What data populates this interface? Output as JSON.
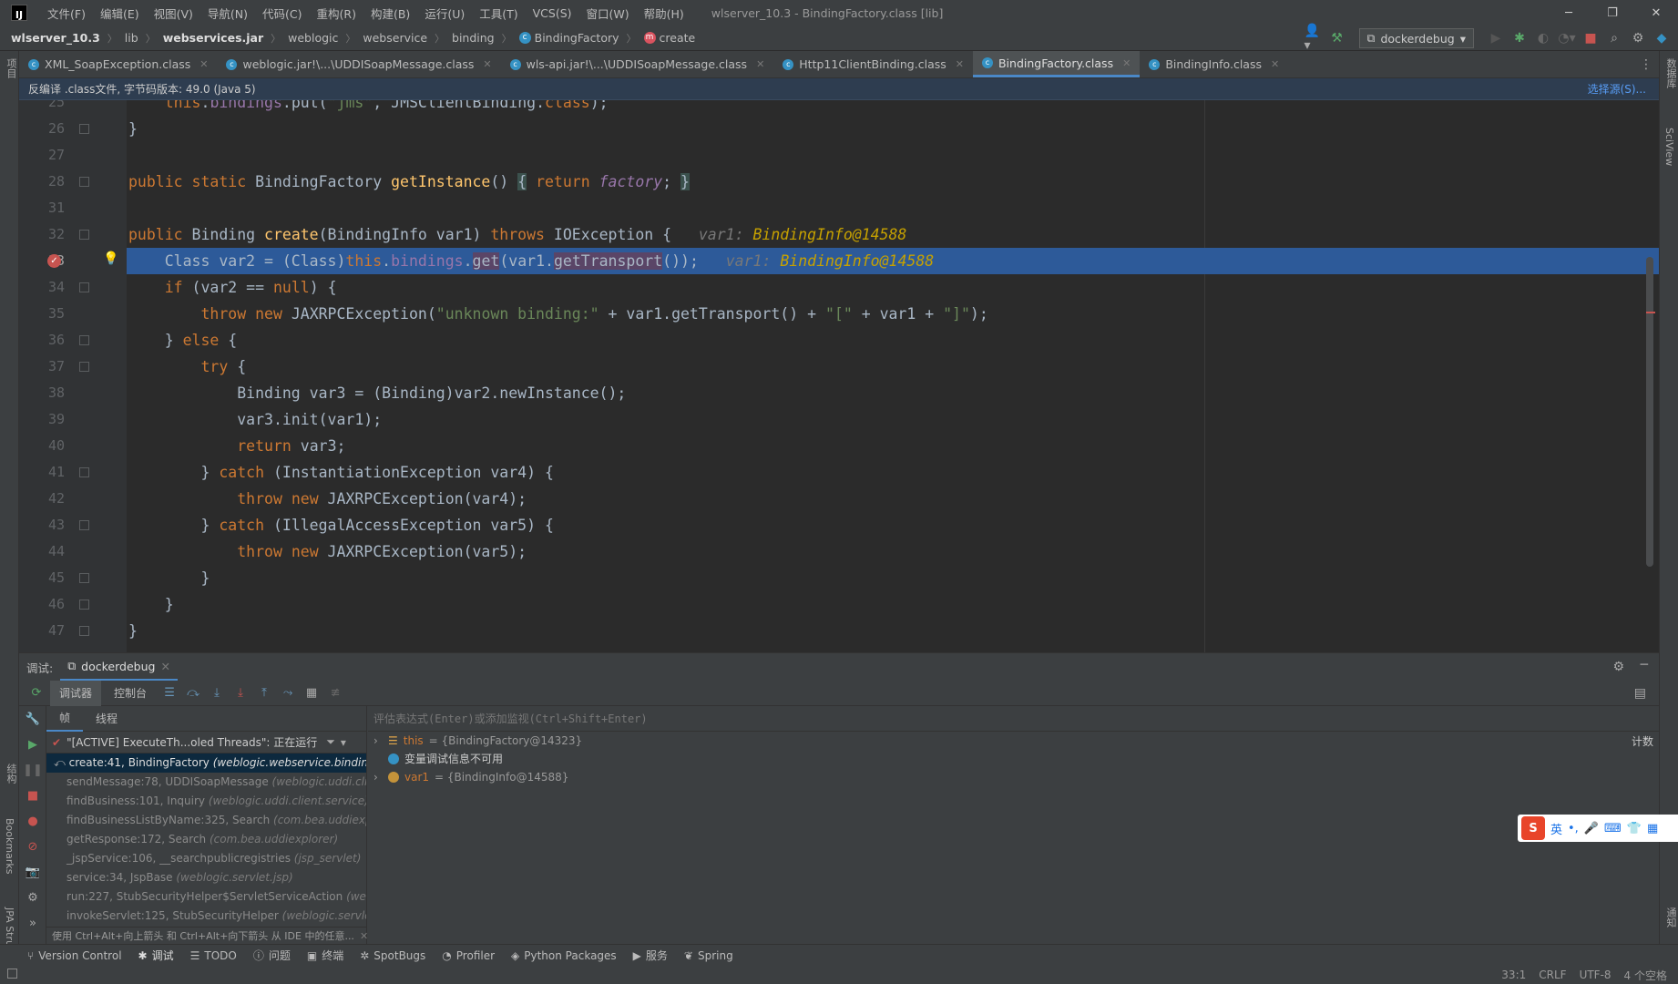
{
  "menu": {
    "items": [
      "文件(F)",
      "编辑(E)",
      "视图(V)",
      "导航(N)",
      "代码(C)",
      "重构(R)",
      "构建(B)",
      "运行(U)",
      "工具(T)",
      "VCS(S)",
      "窗口(W)",
      "帮助(H)"
    ],
    "window_title": "wlserver_10.3 - BindingFactory.class [lib]"
  },
  "breadcrumb": {
    "project": "wlserver_10.3",
    "lib": "lib",
    "jar": "webservices.jar",
    "pkg1": "weblogic",
    "pkg2": "webservice",
    "pkg3": "binding",
    "cls": "BindingFactory",
    "method": "create"
  },
  "toolbar": {
    "run_config": "dockerdebug"
  },
  "tabs": [
    {
      "label": "XML_SoapException.class"
    },
    {
      "label": "weblogic.jar!\\...\\UDDISoapMessage.class"
    },
    {
      "label": "wls-api.jar!\\...\\UDDISoapMessage.class"
    },
    {
      "label": "Http11ClientBinding.class"
    },
    {
      "label": "BindingFactory.class"
    },
    {
      "label": "BindingInfo.class"
    }
  ],
  "infobar": {
    "text": "反编译 .class文件, 字节码版本: 49.0 (Java 5)",
    "link": "选择源(S)..."
  },
  "editor": {
    "line_numbers": [
      "25",
      "26",
      "27",
      "28",
      "31",
      "32",
      "33",
      "34",
      "35",
      "36",
      "37",
      "38",
      "39",
      "40",
      "41",
      "42",
      "43",
      "44",
      "45",
      "46",
      "47"
    ],
    "hint1": "var1: ",
    "hint1_val": "BindingInfo@14588",
    "hint2": "var1: ",
    "hint2_val": "BindingInfo@14588",
    "exc_msg": "\"unknown binding:\"",
    "lb": "\"[\"",
    "rb": "\"]\""
  },
  "left_tool": {
    "project": "项目",
    "bookmarks": "Bookmarks",
    "structure": "结构",
    "jpa": "JPA Structure"
  },
  "right_tool": {
    "db": "数据库",
    "sciview": "SciView",
    "notify": "通知"
  },
  "debug": {
    "label": "调试:",
    "config": "dockerdebug",
    "tab_debugger": "调试器",
    "tab_console": "控制台",
    "tab_frames": "帧",
    "tab_threads": "线程",
    "thread": "\"[ACTIVE] ExecuteTh...oled Threads\": 正在运行",
    "frames": [
      {
        "name": "create:41, BindingFactory ",
        "pkg": "(weblogic.webservice.binding)"
      },
      {
        "name": "sendMessage:78, UDDISoapMessage ",
        "pkg": "(weblogic.uddi.cli"
      },
      {
        "name": "findBusiness:101, Inquiry ",
        "pkg": "(weblogic.uddi.client.service)"
      },
      {
        "name": "findBusinessListByName:325, Search ",
        "pkg": "(com.bea.uddiexpl"
      },
      {
        "name": "getResponse:172, Search ",
        "pkg": "(com.bea.uddiexplorer)"
      },
      {
        "name": "_jspService:106, __searchpublicregistries ",
        "pkg": "(jsp_servlet)"
      },
      {
        "name": "service:34, JspBase ",
        "pkg": "(weblogic.servlet.jsp)"
      },
      {
        "name": "run:227, StubSecurityHelper$ServletServiceAction ",
        "pkg": "(webl"
      },
      {
        "name": "invokeServlet:125, StubSecurityHelper ",
        "pkg": "(weblogic.servlet."
      }
    ],
    "hint": "使用 Ctrl+Alt+向上箭头 和 Ctrl+Alt+向下箭头 从 IDE 中的任意...",
    "eval_placeholder": "评估表达式(Enter)或添加监视(Ctrl+Shift+Enter)",
    "vars": [
      {
        "name": "this",
        "value": " = {BindingFactory@14323}"
      },
      {
        "name": "var1",
        "value": " = {BindingInfo@14588}"
      }
    ],
    "var_info": "变量调试信息不可用",
    "count_label": "计数"
  },
  "statusbar": {
    "items": [
      "Version Control",
      "调试",
      "TODO",
      "问题",
      "终端",
      "SpotBugs",
      "Profiler",
      "Python Packages",
      "服务",
      "Spring"
    ],
    "pos": "33:1",
    "eol": "CRLF",
    "enc": "UTF-8",
    "indent": "4 个空格"
  },
  "ime": {
    "lang": "英"
  }
}
